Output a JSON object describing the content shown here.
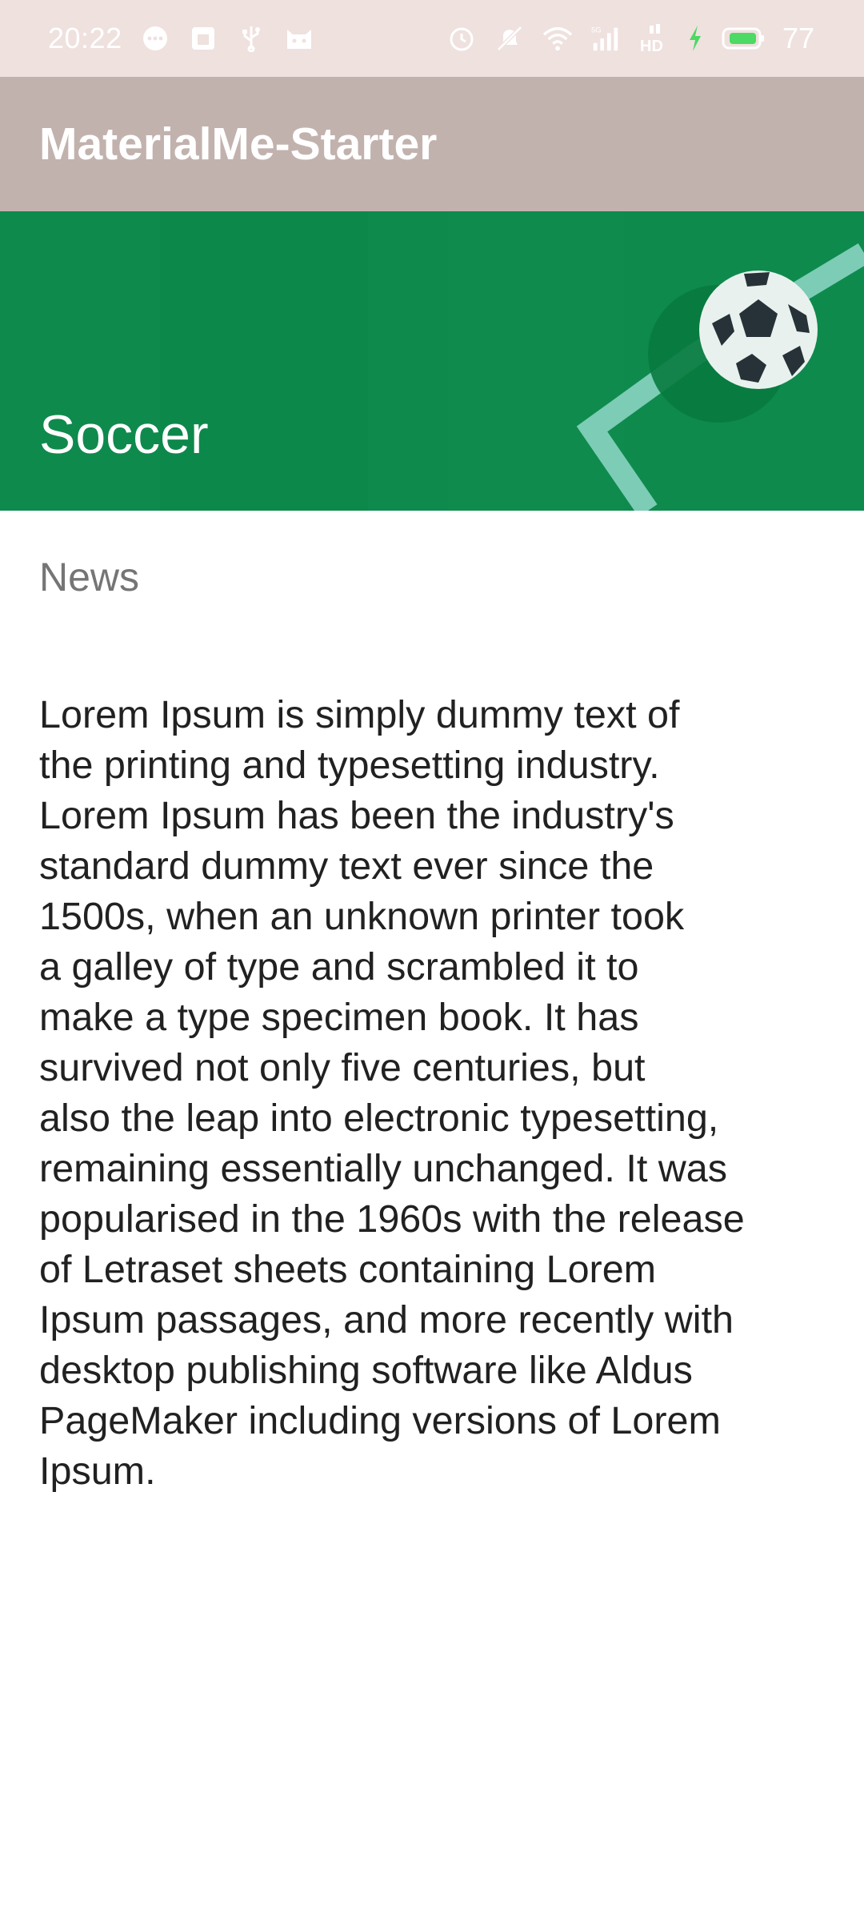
{
  "status_bar": {
    "time": "20:22",
    "battery": "77",
    "left_icons": [
      "chat-bubble-icon",
      "square-app-icon",
      "usb-icon",
      "cat-face-icon"
    ],
    "right_icons": [
      "alarm-icon",
      "mute-icon",
      "wifi-icon",
      "signal-5g-icon",
      "hd-icon",
      "charging-bolt-icon",
      "battery-icon"
    ]
  },
  "app_bar": {
    "title": "MaterialMe-Starter"
  },
  "banner": {
    "title": "Soccer",
    "image": "soccer-ball-field-icon",
    "background_color": "#0d8a4c"
  },
  "content": {
    "subtitle": "News",
    "body": "Lorem Ipsum is simply dummy text of\nthe printing and typesetting industry.\nLorem Ipsum has been the industry's\nstandard dummy text ever since the\n1500s, when an unknown printer took\na galley of type and scrambled it to\nmake a type specimen book. It has\nsurvived not only five centuries, but\nalso the leap into electronic typesetting,\nremaining essentially unchanged. It was\npopularised in the 1960s with the release\nof Letraset sheets containing Lorem\nIpsum passages, and more recently with\ndesktop publishing software like Aldus\nPageMaker including versions of Lorem\nIpsum."
  },
  "colors": {
    "status_bar": "#efe1de",
    "app_bar": "#c2b2ae",
    "banner": "#0d8a4c",
    "subtitle_text": "#757575",
    "body_text": "#212121"
  }
}
